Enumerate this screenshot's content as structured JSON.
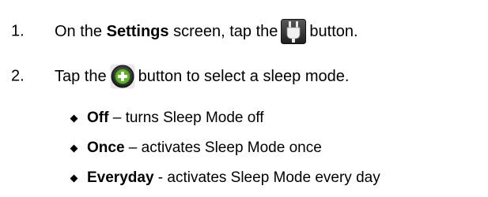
{
  "steps": [
    {
      "number": "1.",
      "text_before": "On the ",
      "bold": "Settings",
      "text_middle": " screen, tap the",
      "icon": "sleep-mode-plug-icon",
      "text_after": "button."
    },
    {
      "number": "2.",
      "text_before": "Tap the",
      "icon": "plus-circle-icon",
      "text_after": "button to select a sleep mode."
    }
  ],
  "options": [
    {
      "name": "Off",
      "separator": " – ",
      "description": "turns Sleep Mode off"
    },
    {
      "name": "Once",
      "separator": " – ",
      "description": "activates Sleep Mode once"
    },
    {
      "name": "Everyday",
      "separator": " - ",
      "description": "activates Sleep Mode every day"
    }
  ],
  "colors": {
    "text": "#000000",
    "icon_plus_green": "#5cb02a",
    "icon_dark": "#2a2a2a"
  }
}
